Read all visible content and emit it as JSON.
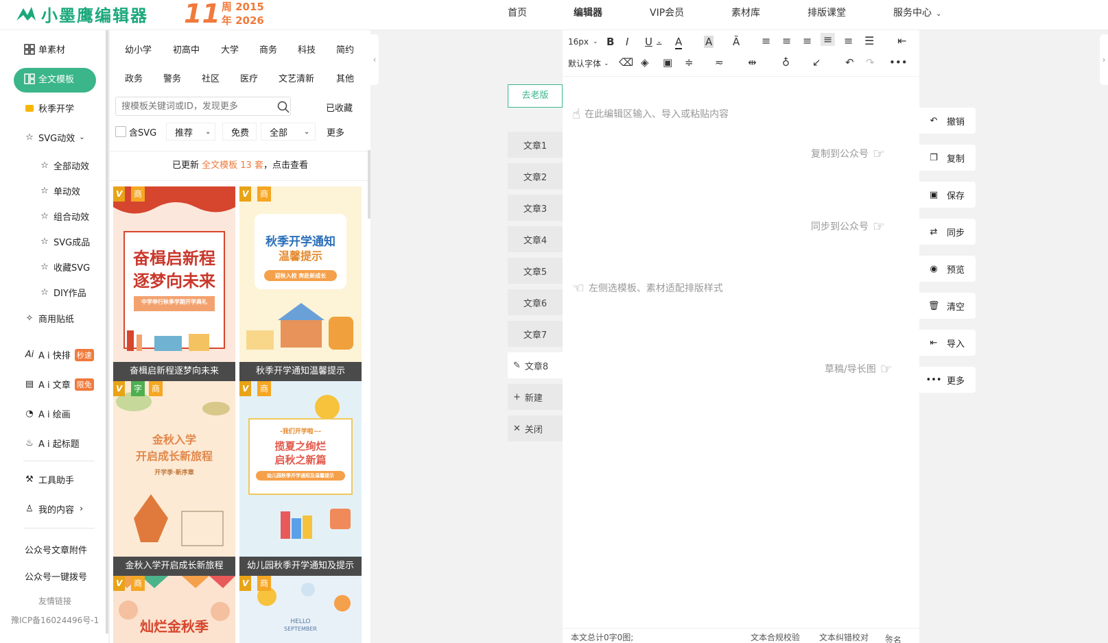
{
  "header": {
    "logo_text": "小墨鹰编辑器",
    "anniv_num": "11",
    "anniv_line1": "周 2015",
    "anniv_line2": "年 2026",
    "nav": [
      "首页",
      "编辑器",
      "VIP会员",
      "素材库",
      "排版课堂",
      "服务中心"
    ]
  },
  "sidebar": {
    "items": [
      {
        "label": "单素材",
        "icon": "grid-icon"
      },
      {
        "label": "全文模板",
        "icon": "template-icon"
      },
      {
        "label": "秋季开学",
        "icon": "bookmark-icon"
      },
      {
        "label": "SVG动效",
        "icon": "star-icon"
      },
      {
        "label": "全部动效",
        "icon": "star-icon"
      },
      {
        "label": "单动效",
        "icon": "star-icon"
      },
      {
        "label": "组合动效",
        "icon": "star-icon"
      },
      {
        "label": "SVG成品",
        "icon": "star-icon"
      },
      {
        "label": "收藏SVG",
        "icon": "star-icon"
      },
      {
        "label": "DIY作品",
        "icon": "star-icon"
      },
      {
        "label": "商用贴纸",
        "icon": "puzzle-icon"
      },
      {
        "label": "A i 快排",
        "icon": "ai-icon",
        "badge": "秒速"
      },
      {
        "label": "A i 文章",
        "icon": "doc-icon",
        "badge": "限免"
      },
      {
        "label": "A i 绘画",
        "icon": "palette-icon"
      },
      {
        "label": "A i 起标题",
        "icon": "fire-icon"
      },
      {
        "label": "工具助手",
        "icon": "tool-icon"
      },
      {
        "label": "我的内容",
        "icon": "user-icon"
      }
    ],
    "links": [
      "公众号文章附件",
      "公众号一键拨号"
    ],
    "friend_links": "友情链接",
    "icp": "豫ICP备16024496号-1"
  },
  "templates": {
    "categories": [
      "幼小学",
      "初高中",
      "大学",
      "商务",
      "科技",
      "简约",
      "政务",
      "警务",
      "社区",
      "医疗",
      "文艺清新",
      "其他"
    ],
    "search_placeholder": "搜模板关键词或ID，发现更多",
    "favorites": "已收藏",
    "filters": {
      "svg": "含SVG",
      "sort": "推荐",
      "price": "免费",
      "scope": "全部",
      "more": "更多"
    },
    "notice_pre": "已更新 ",
    "notice_hl": "全文模板 13 套",
    "notice_post": "，点击查看",
    "cards": [
      {
        "caption": "奋楫启新程逐梦向未来",
        "title1": "奋楫启新程",
        "title2": "逐梦向未来",
        "sub": "中学举行秋季学期开学典礼",
        "tags": [
          "商"
        ]
      },
      {
        "caption": "秋季开学通知温馨提示",
        "title1": "秋季开学通知",
        "title2": "温馨提示",
        "sub": "迎秋入校 奔赴新成长",
        "tags": [
          "商"
        ]
      },
      {
        "caption": "金秋入学开启成长新旅程",
        "title1": "金秋入学",
        "title2": "开启成长新旅程",
        "sub": "开学季·新序章",
        "tags": [
          "字",
          "商"
        ]
      },
      {
        "caption": "幼儿园秋季开学通知及提示",
        "title1": "揽夏之绚烂",
        "title2": "启秋之新篇",
        "sub": "幼儿园秋季开学通知及温馨提示",
        "pre": "-我们开学啦~-",
        "tags": [
          "商"
        ]
      },
      {
        "caption": "",
        "title1": "灿烂金秋季",
        "title2": "",
        "sub": "",
        "tags": [
          "商"
        ]
      },
      {
        "caption": "",
        "title1": "HELLO",
        "title2": "SEPTEMBER",
        "sub": "",
        "tags": [
          "商"
        ]
      }
    ]
  },
  "articles": {
    "old_version": "去老版",
    "tabs": [
      "文章1",
      "文章2",
      "文章3",
      "文章4",
      "文章5",
      "文章6",
      "文章7",
      "文章8"
    ],
    "new": "新建",
    "close": "关闭"
  },
  "editor": {
    "font_size": "16px",
    "font_family": "默认字体",
    "placeholder_input": "在此编辑区输入、导入或粘贴内容",
    "hint_copy": "复制到公众号",
    "hint_sync": "同步到公众号",
    "placeholder_left": "左侧选模板、素材适配排版样式",
    "hint_draft": "草稿/导长图",
    "status_count": "本文总计0字0图;",
    "status_check": "文本合规校验",
    "status_typo": "文本纠错校对",
    "status_sign": "签名"
  },
  "actions": [
    "撤销",
    "复制",
    "保存",
    "同步",
    "预览",
    "清空",
    "导入",
    "更多"
  ],
  "colors": {
    "brand": "#3bb58a",
    "accent": "#f07a3c"
  }
}
